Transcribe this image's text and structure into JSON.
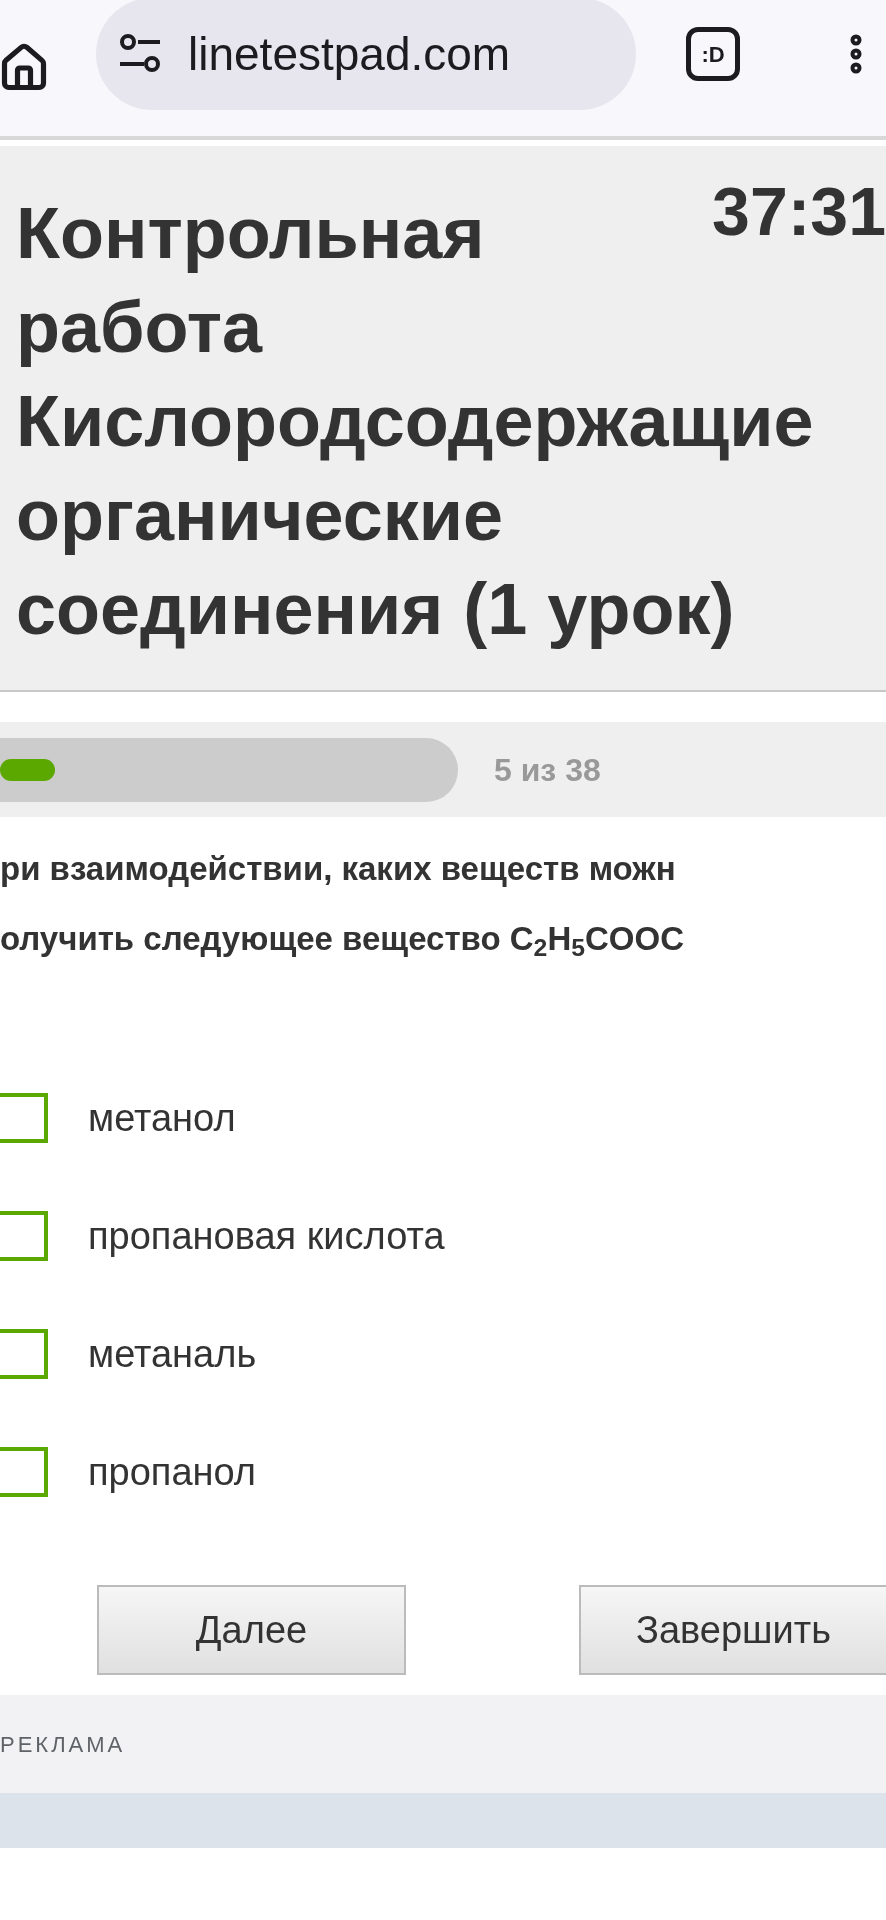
{
  "browser": {
    "url": "linetestpad.com",
    "tabs_label": ":D"
  },
  "header": {
    "title": [
      "Контрольная работа",
      "Кислородсодержащие органические соединения (1 урок)"
    ],
    "timer": "37:31"
  },
  "progress": {
    "level": 0.12,
    "reading": "5 из 38"
  },
  "question": {
    "lines": [
      "ри взаимодействии, каких веществ можн",
      "олучить следующее вещество  C$_{2}$H$_{5}$COOC"
    ]
  },
  "options": [
    {
      "label": "метанол",
      "checked": false
    },
    {
      "label": "пропановая кислота",
      "checked": false
    },
    {
      "label": "метаналь",
      "checked": false
    },
    {
      "label": "пропанол",
      "checked": false
    }
  ],
  "buttons": [
    "Далее",
    "Завершить"
  ],
  "ad": {
    "label": "РЕКЛАМА"
  }
}
